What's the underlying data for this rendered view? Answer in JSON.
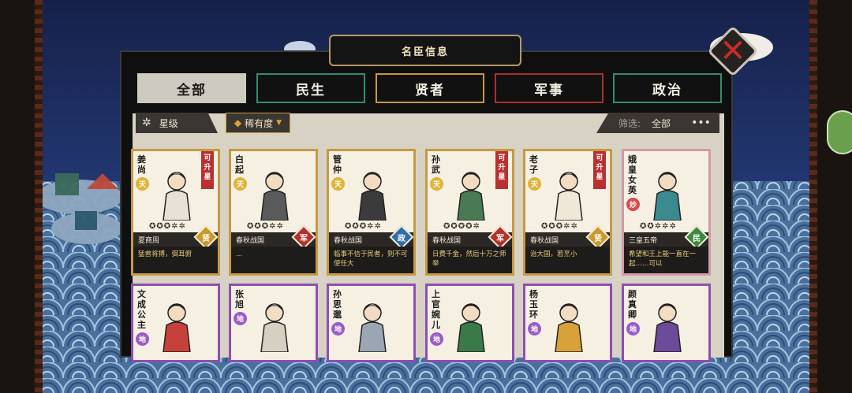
{
  "title": "名臣信息",
  "close_icon": "close-x-icon",
  "tabs": [
    {
      "label": "全部",
      "active": true,
      "color": "#cfcac1"
    },
    {
      "label": "民生",
      "active": false,
      "color": "#2f8f6a"
    },
    {
      "label": "贤者",
      "active": false,
      "color": "#c79a3a"
    },
    {
      "label": "军事",
      "active": false,
      "color": "#a8302f"
    },
    {
      "label": "政治",
      "active": false,
      "color": "#2f8f6a"
    }
  ],
  "filter": {
    "star_label": "星级",
    "rarity_label": "稀有度",
    "filter_label": "筛选:",
    "filter_value": "全部",
    "more": "•••"
  },
  "cards": [
    {
      "name": "姜尚",
      "rank": "天",
      "rank_type": "tian",
      "upgrade": "可升星",
      "era": "夏商周",
      "type": "贤",
      "type_class": "xian",
      "desc": "猛兽将搏，弭耳俯",
      "stars": 3,
      "robe": "#e8e2d6",
      "hair": "#f2f2f2"
    },
    {
      "name": "白起",
      "rank": "天",
      "rank_type": "tian",
      "upgrade": "",
      "era": "春秋战国",
      "type": "军",
      "type_class": "jun",
      "desc": "...",
      "stars": 3,
      "robe": "#5a5a5a",
      "hair": "#1a1a1a"
    },
    {
      "name": "管仲",
      "rank": "天",
      "rank_type": "tian",
      "upgrade": "",
      "era": "春秋战国",
      "type": "政",
      "type_class": "zheng",
      "desc": "临事不信于民者，则不可使任大",
      "stars": 3,
      "robe": "#3b3b3b",
      "hair": "#2a2a2a"
    },
    {
      "name": "孙武",
      "rank": "天",
      "rank_type": "tian",
      "upgrade": "可升星",
      "era": "春秋战国",
      "type": "军",
      "type_class": "jun",
      "desc": "日费千金，然后十万之师举",
      "stars": 4,
      "robe": "#4a7a52",
      "hair": "#1a1a1a"
    },
    {
      "name": "老子",
      "rank": "天",
      "rank_type": "tian",
      "upgrade": "可升星",
      "era": "春秋战国",
      "type": "贤",
      "type_class": "xian",
      "desc": "治大国，若烹小",
      "stars": 3,
      "robe": "#efe8d9",
      "hair": "#f5f5f5"
    },
    {
      "name": "娥皇女英",
      "rank": "妙",
      "rank_type": "miao",
      "upgrade": "",
      "era": "三皇五帝",
      "type": "民",
      "type_class": "min",
      "desc": "希望和王上能一直在一起……可以",
      "stars": 2,
      "robe": "#3b8a8f",
      "hair": "#1a1a1a"
    },
    {
      "name": "文成公主",
      "rank": "地",
      "rank_type": "di",
      "robe": "#c6403c",
      "hair": "#2a1a14"
    },
    {
      "name": "张旭",
      "rank": "地",
      "rank_type": "di",
      "robe": "#d7d0c0",
      "hair": "#cfcfcf"
    },
    {
      "name": "孙思邈",
      "rank": "地",
      "rank_type": "di",
      "robe": "#9aa6b4",
      "hair": "#e8e8e8"
    },
    {
      "name": "上官婉儿",
      "rank": "地",
      "rank_type": "di",
      "robe": "#3a7a4a",
      "hair": "#1a1a1a"
    },
    {
      "name": "杨玉环",
      "rank": "地",
      "rank_type": "di",
      "robe": "#d9a13a",
      "hair": "#2a1a14"
    },
    {
      "name": "颜真卿",
      "rank": "地",
      "rank_type": "di",
      "robe": "#6b4b9a",
      "hair": "#1a1a1a"
    }
  ]
}
